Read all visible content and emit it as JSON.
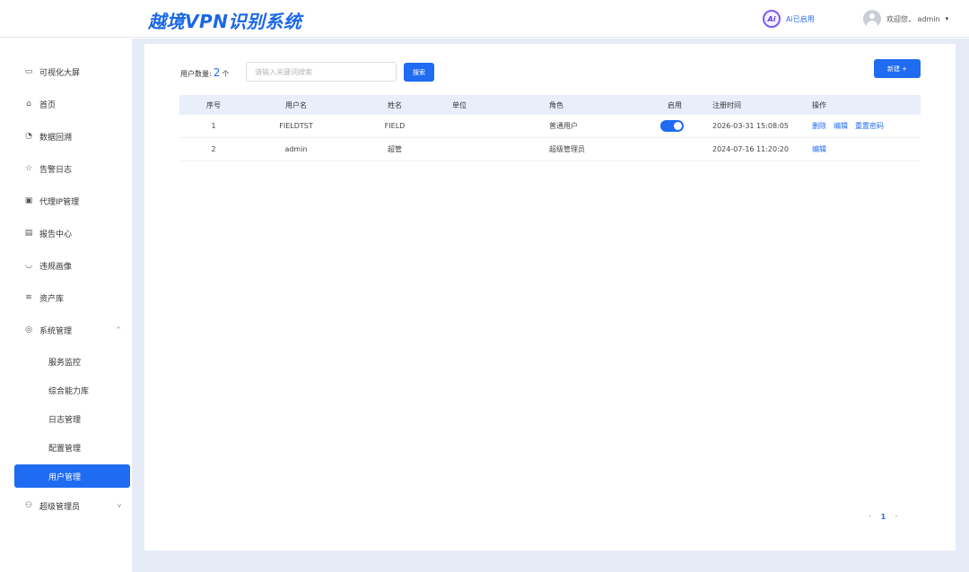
{
  "header": {
    "title": "越境VPN识别系统",
    "ai_icon_text": "Ai",
    "ai_label": "Ai已启用",
    "welcome": "欢迎您， admin",
    "caret": "▾"
  },
  "sidebar": {
    "items": [
      {
        "label": "可视化大屏",
        "icon": "monitor-icon"
      },
      {
        "label": "首页",
        "icon": "home-icon"
      },
      {
        "label": "数据回溯",
        "icon": "clock-icon"
      },
      {
        "label": "告警日志",
        "icon": "alert-icon"
      },
      {
        "label": "代理IP管理",
        "icon": "proxy-icon"
      },
      {
        "label": "报告中心",
        "icon": "report-icon"
      },
      {
        "label": "违规画像",
        "icon": "shield-icon"
      },
      {
        "label": "资产库",
        "icon": "layers-icon"
      },
      {
        "label": "系统管理",
        "icon": "gear-icon"
      },
      {
        "label": "超级管理员",
        "icon": "user-icon"
      }
    ],
    "sub_items": [
      {
        "label": "服务监控"
      },
      {
        "label": "综合能力库"
      },
      {
        "label": "日志管理"
      },
      {
        "label": "配置管理"
      },
      {
        "label": "用户管理"
      }
    ],
    "active_sub": "用户管理"
  },
  "toolbar": {
    "count_label": "用户数量:",
    "count_value": "2",
    "count_unit": "个",
    "search_placeholder": "请输入关键词搜索",
    "search_label": "搜索",
    "new_label": "新建 +"
  },
  "table": {
    "columns": [
      "序号",
      "用户名",
      "姓名",
      "单位",
      "角色",
      "启用",
      "注册时间",
      "操作"
    ],
    "rows": [
      {
        "no": "1",
        "username": "FIELDTST",
        "name": "FIELD",
        "unit": "",
        "role": "普通用户",
        "enabled": true,
        "reg_time": "2026-03-31 15:08:05",
        "actions": [
          "删除",
          "编辑",
          "重置密码"
        ]
      },
      {
        "no": "2",
        "username": "admin",
        "name": "超管",
        "unit": "",
        "role": "超级管理员",
        "enabled": false,
        "reg_time": "2024-07-16 11:20:20",
        "actions": [
          "编辑"
        ]
      }
    ]
  },
  "pagination": {
    "prev": "‹",
    "current": "1",
    "next": "›"
  },
  "colors": {
    "primary": "#1f6bf2",
    "content_bg": "#e6ecf7",
    "header_row": "#e8eefa"
  }
}
